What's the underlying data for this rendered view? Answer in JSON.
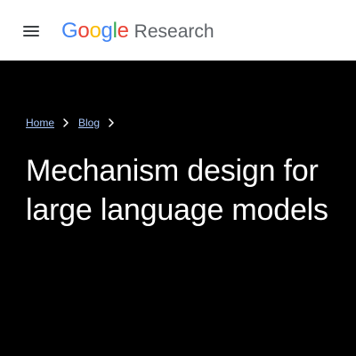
{
  "header": {
    "menu_icon": "hamburger-menu-icon",
    "logo": {
      "letters": [
        {
          "char": "G",
          "color": "#4285F4"
        },
        {
          "char": "o",
          "color": "#EA4335"
        },
        {
          "char": "o",
          "color": "#FBBC05"
        },
        {
          "char": "g",
          "color": "#4285F4"
        },
        {
          "char": "l",
          "color": "#34A853"
        },
        {
          "char": "e",
          "color": "#EA4335"
        }
      ],
      "product": "Research"
    }
  },
  "breadcrumb": {
    "items": [
      {
        "label": "Home"
      },
      {
        "label": "Blog"
      }
    ],
    "separator_icon": "chevron-right-icon",
    "link_color": "#a8c7fa"
  },
  "article": {
    "title": "Mechanism design for large language models"
  },
  "colors": {
    "header_background": "#ffffff",
    "hero_background": "#000000",
    "title_text": "#ffffff"
  }
}
